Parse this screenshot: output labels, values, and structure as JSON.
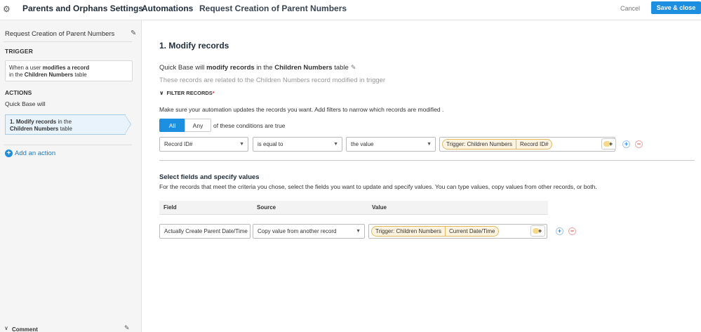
{
  "header": {
    "app_title": "Parents and Orphans Settings",
    "automations": "Automations",
    "request_title": "Request Creation of Parent Numbers",
    "cancel": "Cancel",
    "save_close": "Save & close"
  },
  "sidebar": {
    "title": "Request Creation of Parent Numbers",
    "trigger_heading": "TRIGGER",
    "trigger_box": {
      "line1_a": "When a user ",
      "line1_b": "modifies a record",
      "line2_a": "in the ",
      "line2_b": "Children Numbers",
      "line2_c": " table"
    },
    "actions_heading": "ACTIONS",
    "quickbase_will": "Quick Base will",
    "action": {
      "line1_a": "1. Modify records",
      "line1_b": " in the",
      "line2_a": "Children Numbers",
      "line2_b": " table"
    },
    "add_action": "Add an action",
    "comment": "Comment"
  },
  "main": {
    "heading": "1. Modify records",
    "desc": {
      "a": "Quick Base will ",
      "b": "modify records",
      "c": " in the ",
      "d": "Children Numbers",
      "e": " table"
    },
    "related": "These records are related to the Children Numbers record modified in trigger",
    "filter_heading": "FILTER RECORDS",
    "filter_required": "*",
    "filter_desc": "Make sure your automation updates the records you want. Add filters to narrow which records are modified .",
    "seg_all": "All",
    "seg_any": "Any",
    "seg_tail": "of these conditions are true",
    "condition": {
      "field": "Record ID#",
      "operator": "is equal to",
      "value_type": "the value",
      "pill_a": "Trigger: Children Numbers",
      "pill_b": "Record ID#"
    },
    "fields_heading": "Select fields and specify values",
    "fields_desc": "For the records that meet the criteria you chose, select the fields you want to update and specify values. You can type values, copy values from other records, or both.",
    "columns": [
      "Field",
      "Source",
      "Value"
    ],
    "row": {
      "field": "Actually Create Parent Date/Time",
      "source": "Copy value from another record",
      "pill_a": "Trigger: Children Numbers",
      "pill_b": "Current Date/Time"
    }
  }
}
